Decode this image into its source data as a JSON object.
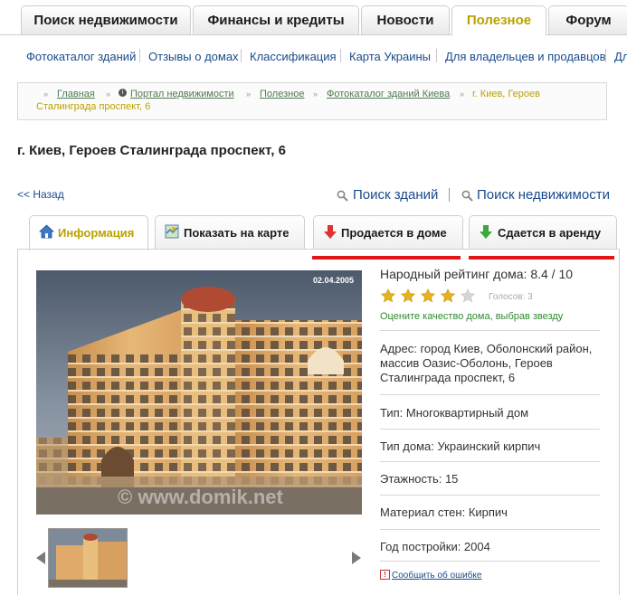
{
  "top_tabs": [
    "Поиск недвижимости",
    "Финансы и кредиты",
    "Новости",
    "Полезное",
    "Форум"
  ],
  "subnav": [
    "Фотокаталог зданий",
    "Отзывы о домах",
    "Классификация",
    "Карта Украины",
    "Для владельцев и продавцов",
    "Дл"
  ],
  "breadcrumbs": {
    "items": [
      "Главная",
      "Портал недвижимости",
      "Полезное",
      "Фотокаталог зданий Киева"
    ],
    "current_line1": "г. Киев, Героев",
    "current_line2": "Сталинграда проспект, 6"
  },
  "page_title": "г. Киев, Героев Сталинграда проспект, 6",
  "back_link": "<< Назад",
  "search_links": [
    "Поиск зданий",
    "Поиск недвижимости"
  ],
  "content_tabs": [
    "Информация",
    "Показать на карте",
    "Продается в доме",
    "Сдается в аренду"
  ],
  "photo": {
    "date": "02.04.2005",
    "watermark": "© www.domik.net"
  },
  "rating": {
    "label": "Народный рейтинг дома: 8.4 / 10",
    "stars_filled": 4,
    "stars_total": 5,
    "votes": "Голосов:  3",
    "hint": "Оцените качество дома, выбрав звезду"
  },
  "address": "Адрес: город Киев, Оболонский район, массив Оазис-Оболонь, Героев Сталинграда проспект, 6",
  "details": [
    "Тип: Многоквартирный дом",
    "Тип дома: Украинский кирпич",
    "Этажность: 15",
    "Материал стен: Кирпич",
    "Год постройки: 2004"
  ],
  "report_link": "Сообщить об ошибке",
  "colors": {
    "accent_yellow": "#b8a300",
    "link_blue": "#1a4b8c",
    "highlight_red": "#e31616",
    "hint_green": "#2f8a2f"
  }
}
